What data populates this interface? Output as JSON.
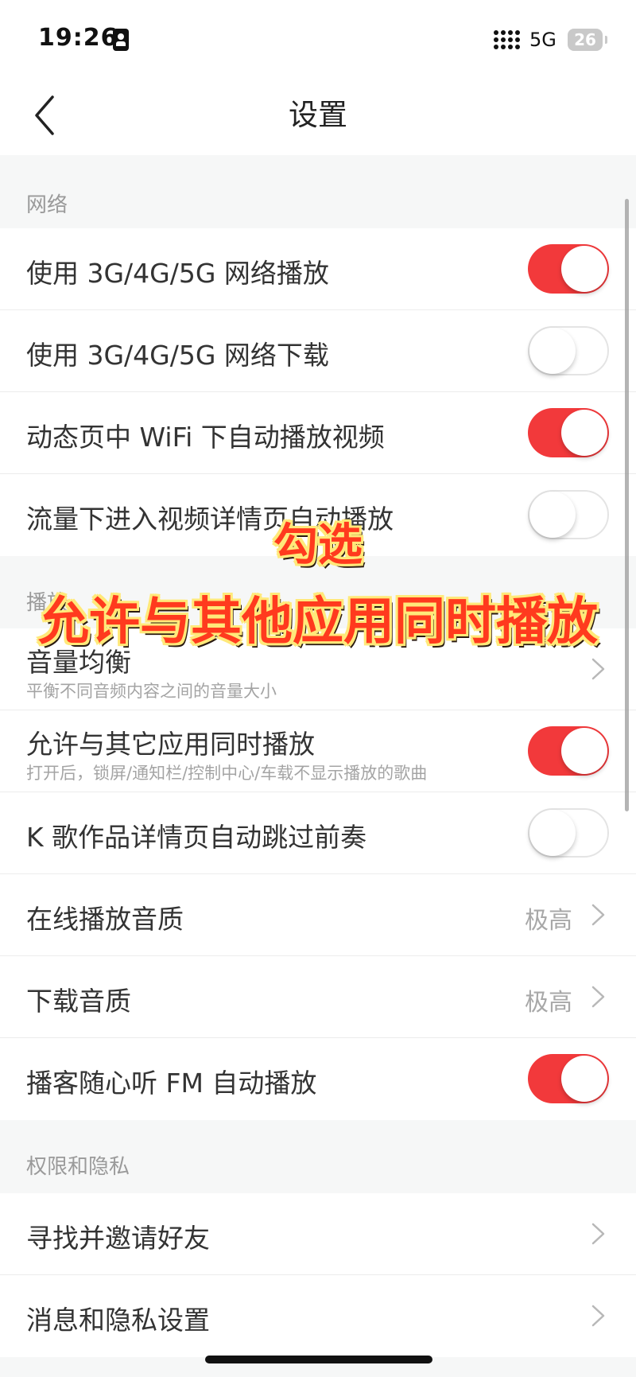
{
  "status_bar": {
    "time": "19:26",
    "network": "5G",
    "battery": "26"
  },
  "nav": {
    "title": "设置"
  },
  "sections": {
    "network": {
      "header": "网络"
    },
    "playback": {
      "header": "播放"
    },
    "privacy": {
      "header": "权限和隐私"
    }
  },
  "rows": [
    {
      "title": "使用 3G/4G/5G 网络播放",
      "toggle": "on"
    },
    {
      "title": "使用 3G/4G/5G 网络下载",
      "toggle": "off"
    },
    {
      "title": "动态页中 WiFi 下自动播放视频",
      "toggle": "on"
    },
    {
      "title": "流量下进入视频详情页自动播放",
      "toggle": "off"
    },
    {
      "title": "音量均衡",
      "subtitle": "平衡不同音频内容之间的音量大小",
      "control": "chevron"
    },
    {
      "title": "允许与其它应用同时播放",
      "subtitle": "打开后，锁屏/通知栏/控制中心/车载不显示播放的歌曲",
      "toggle": "on"
    },
    {
      "title": "K 歌作品详情页自动跳过前奏",
      "toggle": "off"
    },
    {
      "title": "在线播放音质",
      "value": "极高",
      "control": "chevron"
    },
    {
      "title": "下载音质",
      "value": "极高",
      "control": "chevron"
    },
    {
      "title": "播客随心听 FM 自动播放",
      "toggle": "on"
    },
    {
      "title": "寻找并邀请好友",
      "control": "chevron"
    },
    {
      "title": "消息和隐私设置",
      "control": "chevron"
    }
  ],
  "overlay": {
    "line1": "勾选",
    "line2": "允许与其他应用同时播放"
  },
  "colors": {
    "accent": "#f2393b",
    "background": "#f6f7f7",
    "overlay_text": "#ff3a1e",
    "overlay_outline": "#ffe97a"
  }
}
